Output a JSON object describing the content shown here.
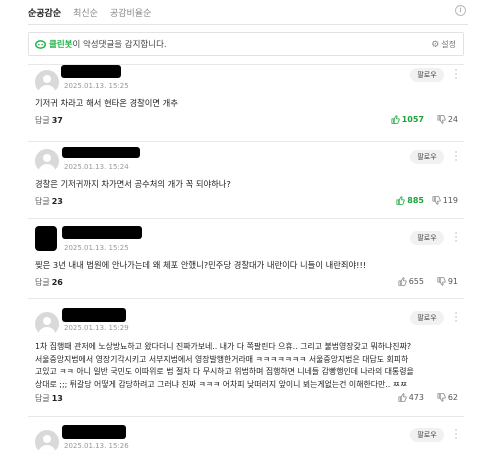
{
  "sort_tabs": [
    "순공감순",
    "최신순",
    "공감비율순"
  ],
  "info_icon": "i",
  "cleanbot": {
    "brand": "클린봇",
    "message": "이 악성댓글을 감지합니다.",
    "settings_label": "설정",
    "accent_color": "#21b34a"
  },
  "comments": [
    {
      "date": "2025.01.13. 15:25",
      "follow_label": "팔로우",
      "text": "기저귀 차라고 해서 현타온 경찰이면 개추",
      "reply_label": "답글",
      "reply_count": "37",
      "likes": "1057",
      "dislikes": "24",
      "liked": true
    },
    {
      "date": "2025.01.13. 15:24",
      "follow_label": "팔로우",
      "text": "경찰은 기저귀까지 차가면서 공수처의 개가 꼭 되야하나?",
      "reply_label": "답글",
      "reply_count": "23",
      "likes": "885",
      "dislikes": "119",
      "liked": true
    },
    {
      "date": "2025.01.13. 15:25",
      "follow_label": "팔로우",
      "text": "찢은 3년 내내 법원에 안나가는데 왜 체포 안했니?민주당 경찰대가 내란이다 니들이 내란죄야!!!",
      "reply_label": "답글",
      "reply_count": "26",
      "likes": "655",
      "dislikes": "91",
      "liked": false
    },
    {
      "date": "2025.01.13. 15:29",
      "follow_label": "팔로우",
      "text_lines": [
        "1차 집행때 관저에 노상방뇨하고 왔다더니 진짜가보네.. 내가 다 쪽팔린다 으휴.. 그리고 불법영장갖고 뭐하냐진짜?",
        "서울중앙지법에서 영장기각시키고 서부지법에서 영장발행한거라매 ㅋㅋㅋㅋㅋㅋㅋ 서울중앙지법은 대답도 회피하",
        "고있고 ㅋㅋ 아니 일반 국민도 이따위로 법 절차 다 무시하고 위법하며 집행하면 니네들 감빵행인데 나라의 대통령을",
        "상대로 ;;; 튀갈당 어떻게 감당하려고 그러냐 진짜 ㅋㅋㅋ 어차피 낮떠러지 앞이니 뵈는게없는건 이해한다만.. ㅉㅉ"
      ],
      "reply_label": "답글",
      "reply_count": "13",
      "likes": "473",
      "dislikes": "62",
      "liked": false
    },
    {
      "date": "2025.01.13. 15:26",
      "follow_label": "팔로우"
    }
  ],
  "colors": {
    "like_active": "#1aa63a",
    "muted": "#999999",
    "border": "#e2e2e2"
  }
}
